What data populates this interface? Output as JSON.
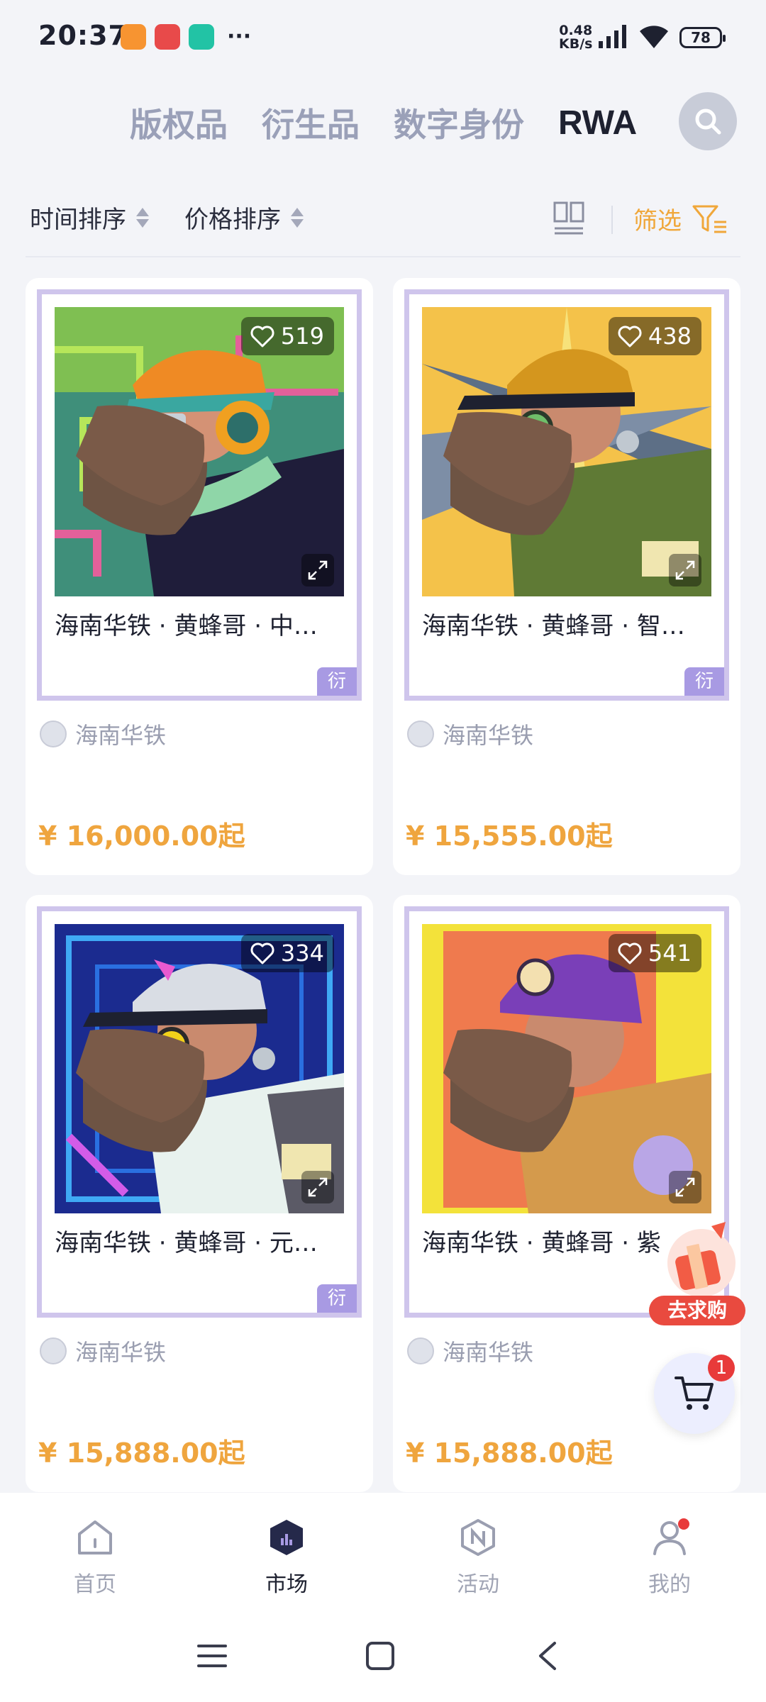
{
  "status_bar": {
    "time": "20:37",
    "net_speed_value": "0.48",
    "net_speed_unit": "KB/s",
    "battery": "78",
    "app_icons": [
      "video-app-icon",
      "toutiao-app-icon",
      "music-app-icon"
    ]
  },
  "top_tabs": [
    {
      "label": "版权品",
      "active": false
    },
    {
      "label": "衍生品",
      "active": false
    },
    {
      "label": "数字身份",
      "active": false
    },
    {
      "label": "RWA",
      "active": true
    }
  ],
  "sort_bar": {
    "time_sort": "时间排序",
    "price_sort": "价格排序",
    "filter": "筛选"
  },
  "cards": [
    {
      "title": "海南华铁 · 黄蜂哥 · 中…",
      "likes": "519",
      "badge": "衍",
      "issuer": "海南华铁",
      "price": "¥ 16,000.00起",
      "palette": "teal-circuit"
    },
    {
      "title": "海南华铁 · 黄蜂哥 · 智…",
      "likes": "438",
      "badge": "衍",
      "issuer": "海南华铁",
      "price": "¥ 15,555.00起",
      "palette": "sunburst"
    },
    {
      "title": "海南华铁 · 黄蜂哥 · 元…",
      "likes": "334",
      "badge": "衍",
      "issuer": "海南华铁",
      "price": "¥ 15,888.00起",
      "palette": "neon-blue"
    },
    {
      "title": "海南华铁 · 黄蜂哥 · 紫",
      "likes": "541",
      "badge": "",
      "issuer": "海南华铁",
      "price": "¥ 15,888.00起",
      "palette": "pop-yellow"
    }
  ],
  "floating": {
    "promo_label": "去求购",
    "cart_count": "1"
  },
  "bottom_nav": [
    {
      "label": "首页",
      "icon": "home-icon",
      "active": false
    },
    {
      "label": "市场",
      "icon": "market-icon",
      "active": true
    },
    {
      "label": "活动",
      "icon": "activity-icon",
      "active": false
    },
    {
      "label": "我的",
      "icon": "profile-icon",
      "active": false
    }
  ],
  "colors": {
    "accent_orange": "#efa53e",
    "badge_purple": "#a89ae3",
    "frame_lavender": "#cfc5ec",
    "text_dark": "#1e2130",
    "muted": "#9aa0b8"
  }
}
